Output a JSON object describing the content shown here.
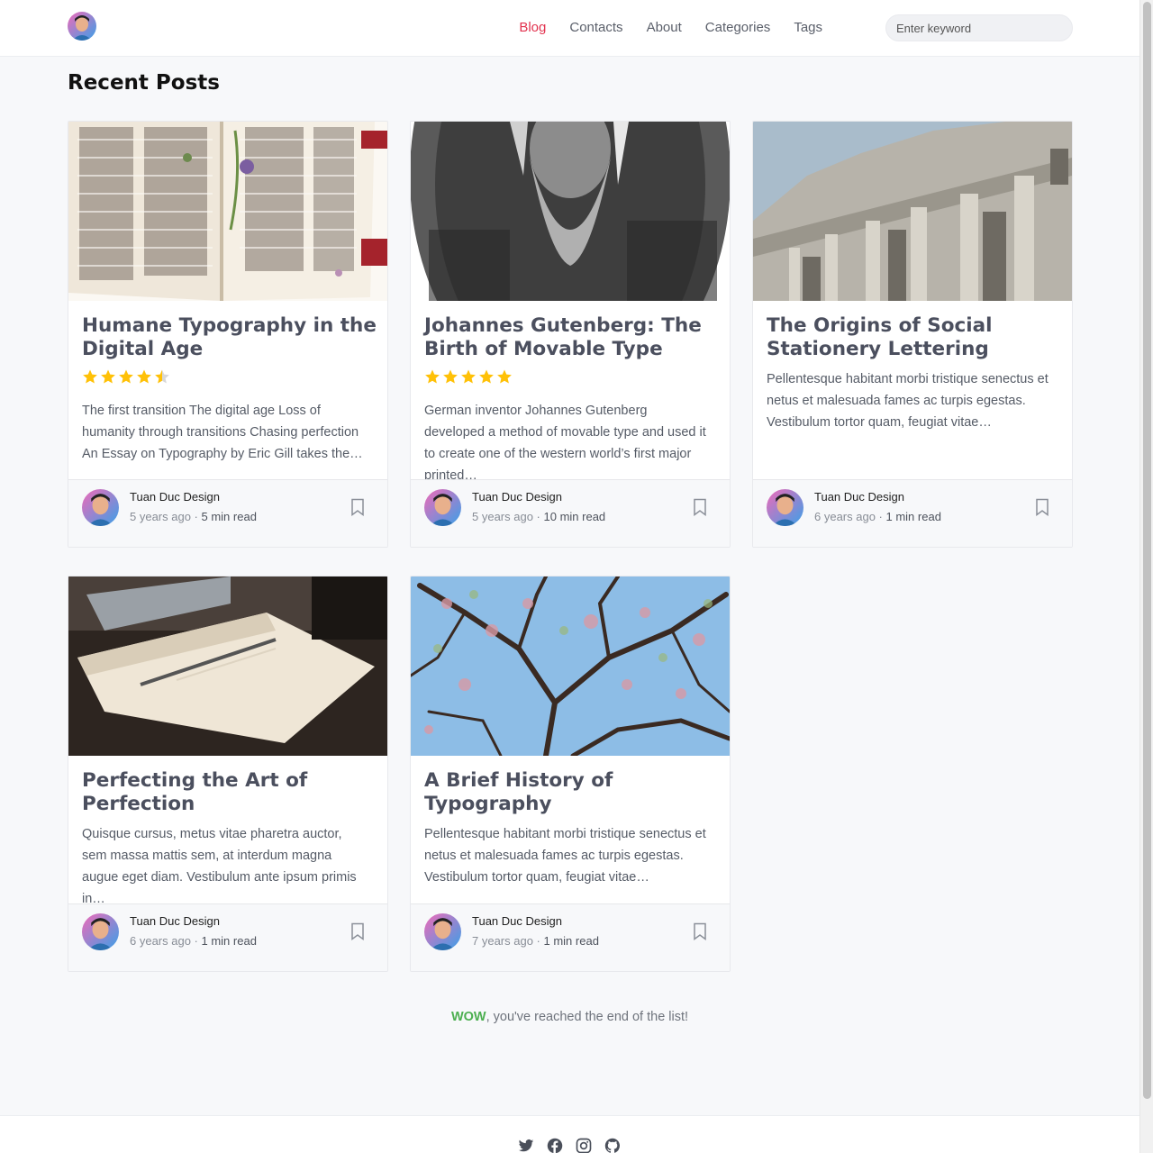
{
  "header": {
    "nav": [
      "Blog",
      "Contacts",
      "About",
      "Categories",
      "Tags"
    ],
    "active_nav": "Blog",
    "search_placeholder": "Enter keyword"
  },
  "page_title": "Recent Posts",
  "posts": [
    {
      "title": "Humane Typography in the Digital Age",
      "rating": 4.5,
      "excerpt": "The first transition The digital age Loss of humanity through transitions Chasing perfection An Essay on Typography by Eric Gill takes the…",
      "author": "Tuan Duc Design",
      "age": "5 years ago",
      "sep": " · ",
      "read": "5 min read",
      "image_icon": "old-manuscript-image"
    },
    {
      "title": "Johannes Gutenberg: The Birth of Movable Type",
      "rating": 5,
      "excerpt": "German inventor Johannes Gutenberg developed a method of movable type and used it to create one of the western world’s first major printed…",
      "author": "Tuan Duc Design",
      "age": "5 years ago",
      "sep": " · ",
      "read": "10 min read",
      "image_icon": "gutenberg-portrait-image"
    },
    {
      "title": "The Origins of Social Stationery Lettering",
      "excerpt": "Pellentesque habitant morbi tristique senectus et netus et malesuada fames ac turpis egestas. Vestibulum tortor quam, feugiat vitae…",
      "author": "Tuan Duc Design",
      "age": "6 years ago",
      "sep": " · ",
      "read": "1 min read",
      "image_icon": "building-facade-image"
    },
    {
      "title": "Perfecting the Art of Perfection",
      "excerpt": "Quisque cursus, metus vitae pharetra auctor, sem massa mattis sem, at interdum magna augue eget diam. Vestibulum ante ipsum primis in…",
      "author": "Tuan Duc Design",
      "age": "6 years ago",
      "sep": " · ",
      "read": "1 min read",
      "image_icon": "notebook-image"
    },
    {
      "title": "A Brief History of Typography",
      "excerpt": "Pellentesque habitant morbi tristique senectus et netus et malesuada fames ac turpis egestas. Vestibulum tortor quam, feugiat vitae…",
      "author": "Tuan Duc Design",
      "age": "7 years ago",
      "sep": " · ",
      "read": "1 min read",
      "image_icon": "tree-branches-image"
    }
  ],
  "end_note": {
    "wow": "WOW",
    "rest": ", you've reached the end of the list!"
  },
  "footer": {
    "icons": [
      "twitter-icon",
      "facebook-icon",
      "instagram-icon",
      "github-icon"
    ]
  },
  "colors": {
    "accent": "#e2334f",
    "star": "#ffc107",
    "wow": "#4caf50"
  }
}
